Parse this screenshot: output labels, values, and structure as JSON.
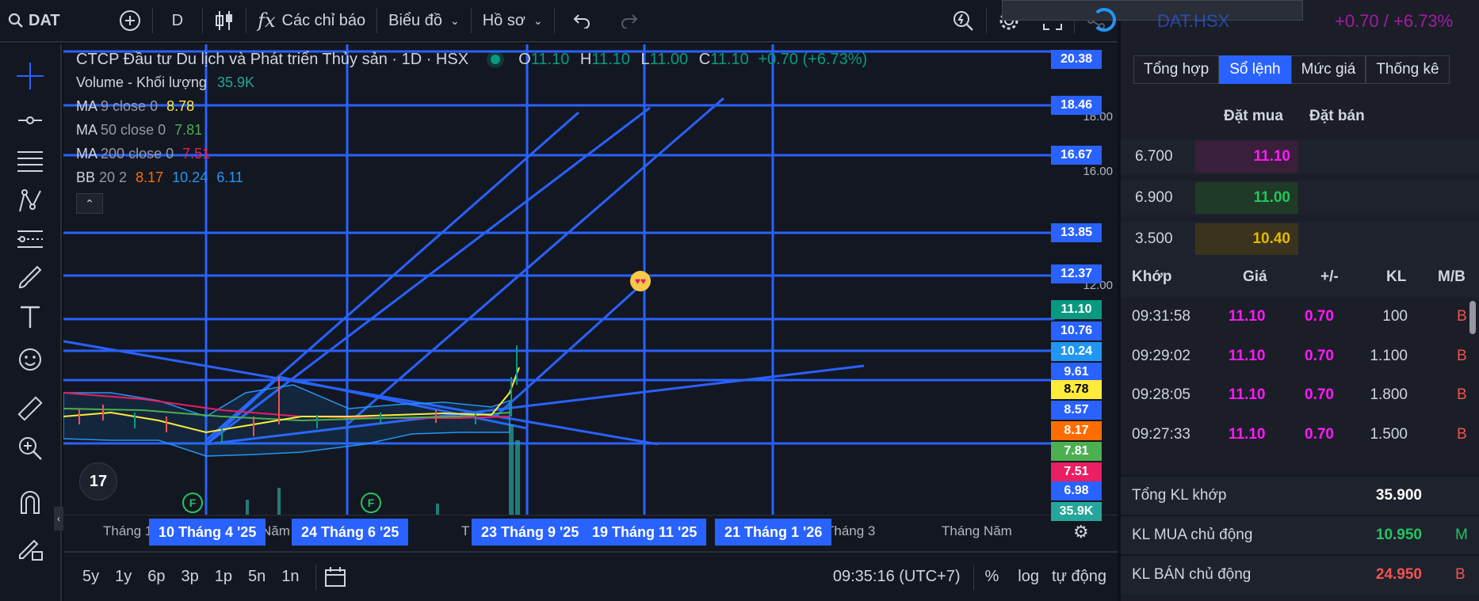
{
  "topbar": {
    "symbol": "DAT",
    "interval": "D",
    "indicators_label": "Các chỉ báo",
    "chart_type_label": "Biểu đồ",
    "profile_label": "Hồ sơ"
  },
  "legend": {
    "title": "CTCP Đầu tư Du lịch và Phát triển Thủy sản · 1D · HSX",
    "o_label": "O",
    "o_val": "11.10",
    "h_label": "H",
    "h_val": "11.10",
    "l_label": "L",
    "l_val": "11.00",
    "c_label": "C",
    "c_val": "11.10",
    "change": "+0.70 (+6.73%)",
    "volume_label": "Volume - Khối lượng",
    "volume_val": "35.9K",
    "ma9_name": "MA",
    "ma9_params": "9 close 0",
    "ma9_val": "8.78",
    "ma50_name": "MA",
    "ma50_params": "50 close 0",
    "ma50_val": "7.81",
    "ma200_name": "MA",
    "ma200_params": "200 close 0",
    "ma200_val": "7.51",
    "bb_name": "BB",
    "bb_params": "20 2",
    "bb_v1": "8.17",
    "bb_v2": "10.24",
    "bb_v3": "6.11"
  },
  "price_axis": {
    "labels": [
      {
        "text": "20.38",
        "color": "#2962ff"
      },
      {
        "text": "18.46",
        "color": "#2962ff"
      },
      {
        "text": "16.67",
        "color": "#2962ff"
      },
      {
        "text": "13.85",
        "color": "#2962ff"
      },
      {
        "text": "12.37",
        "color": "#2962ff"
      },
      {
        "text": "11.10",
        "color": "#089981"
      },
      {
        "text": "10.76",
        "color": "#2962ff"
      },
      {
        "text": "10.24",
        "color": "#2196f3"
      },
      {
        "text": "9.61",
        "color": "#2962ff"
      },
      {
        "text": "8.78",
        "color": "#ffeb3b"
      },
      {
        "text": "8.57",
        "color": "#2962ff"
      },
      {
        "text": "8.17",
        "color": "#ff6d00"
      },
      {
        "text": "7.81",
        "color": "#4caf50"
      },
      {
        "text": "7.51",
        "color": "#e91e63"
      },
      {
        "text": "6.98",
        "color": "#2962ff"
      },
      {
        "text": "35.9K",
        "color": "#26a69a"
      }
    ],
    "ticks": [
      "18.00",
      "16.00",
      "12.00"
    ]
  },
  "time_axis": {
    "labels": [
      "Tháng 1",
      "Năm",
      "T",
      "Tháng 3",
      "Tháng Năm"
    ],
    "selected": [
      "10 Tháng 4 '25",
      "24 Tháng 6 '25",
      "23 Tháng 9 '25",
      "19 Tháng 11 '25",
      "21 Tháng 1 '26"
    ]
  },
  "bottombar": {
    "ranges": [
      "5y",
      "1y",
      "6p",
      "3p",
      "1p",
      "5n",
      "1n"
    ],
    "clock": "09:35:16 (UTC+7)",
    "percent": "%",
    "log": "log",
    "auto": "tự động"
  },
  "right": {
    "header_symbol": "DAT.HSX",
    "header_change": "+0.70 / +6.73%",
    "tabs": [
      "Tổng hợp",
      "Sổ lệnh",
      "Mức giá",
      "Thống kê"
    ],
    "orderbook_head": {
      "buy": "Đặt mua",
      "sell": "Đặt bán"
    },
    "orderbook": [
      {
        "vol": "6.700",
        "price": "11.10",
        "color": "#ff19ff",
        "bg": "#3a1f3a"
      },
      {
        "vol": "6.900",
        "price": "11.00",
        "color": "#22c55e",
        "bg": "#1f3a26"
      },
      {
        "vol": "3.500",
        "price": "10.40",
        "color": "#e6b800",
        "bg": "#3a341f"
      }
    ],
    "trades_head": [
      "Khớp",
      "Giá",
      "+/-",
      "KL",
      "M/B"
    ],
    "trades": [
      {
        "time": "09:31:58",
        "price": "11.10",
        "chg": "0.70",
        "vol": "100",
        "side": "B"
      },
      {
        "time": "09:29:02",
        "price": "11.10",
        "chg": "0.70",
        "vol": "1.100",
        "side": "B"
      },
      {
        "time": "09:28:05",
        "price": "11.10",
        "chg": "0.70",
        "vol": "1.800",
        "side": "B"
      },
      {
        "time": "09:27:33",
        "price": "11.10",
        "chg": "0.70",
        "vol": "1.500",
        "side": "B"
      }
    ],
    "summary": [
      {
        "label": "Tổng KL khớp",
        "value": "35.900",
        "color": "#ffffff",
        "tag": ""
      },
      {
        "label": "KL MUA chủ động",
        "value": "10.950",
        "color": "#22c55e",
        "tag": "M"
      },
      {
        "label": "KL BÁN chủ động",
        "value": "24.950",
        "color": "#ef5350",
        "tag": "B"
      }
    ]
  },
  "colors": {
    "accent": "#2962ff",
    "up": "#089981",
    "down": "#ef5350"
  }
}
